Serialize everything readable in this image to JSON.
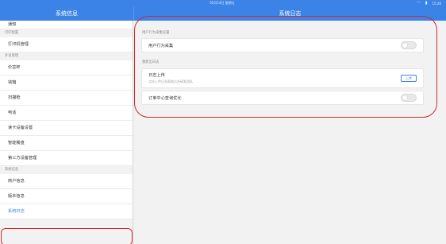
{
  "statusbar": {
    "time": "05月14日 星期五",
    "wifi_icon": "wifi-icon",
    "battery_icon": "battery-icon",
    "clock": "15:26"
  },
  "left_header": {
    "title": "系统信息"
  },
  "right_header": {
    "title": "系统日志"
  },
  "sidebar": {
    "items": [
      {
        "type": "item",
        "label": "通知",
        "small": true
      },
      {
        "type": "section",
        "label": "打印配置"
      },
      {
        "type": "item",
        "label": "打印机管理"
      },
      {
        "type": "section",
        "label": "外设管理"
      },
      {
        "type": "item",
        "label": "价签秤"
      },
      {
        "type": "item",
        "label": "钱箱"
      },
      {
        "type": "item",
        "label": "扫描枪"
      },
      {
        "type": "item",
        "label": "电话"
      },
      {
        "type": "item",
        "label": "读卡设备设置"
      },
      {
        "type": "item",
        "label": "智能餐盘"
      },
      {
        "type": "item",
        "label": "第三方设备管理"
      },
      {
        "type": "section",
        "label": "系统信息"
      },
      {
        "type": "item",
        "label": "商户信息"
      },
      {
        "type": "item",
        "label": "版本信息"
      },
      {
        "type": "item",
        "label": "系统日志",
        "active": true
      }
    ]
  },
  "content": {
    "section1": "用户行为采集设置",
    "behavior_collect": {
      "label": "用户行为采集",
      "on": false
    },
    "section2": "重新出日志",
    "log_upload": {
      "label": "日志上传",
      "sub": "点击上传日志帮助后台研发团队",
      "button": "上传"
    },
    "order_optimize": {
      "label": "订单中心查询优化",
      "on": false
    }
  },
  "colors": {
    "accent": "#3b83e6",
    "highlight": "#d0282f"
  }
}
